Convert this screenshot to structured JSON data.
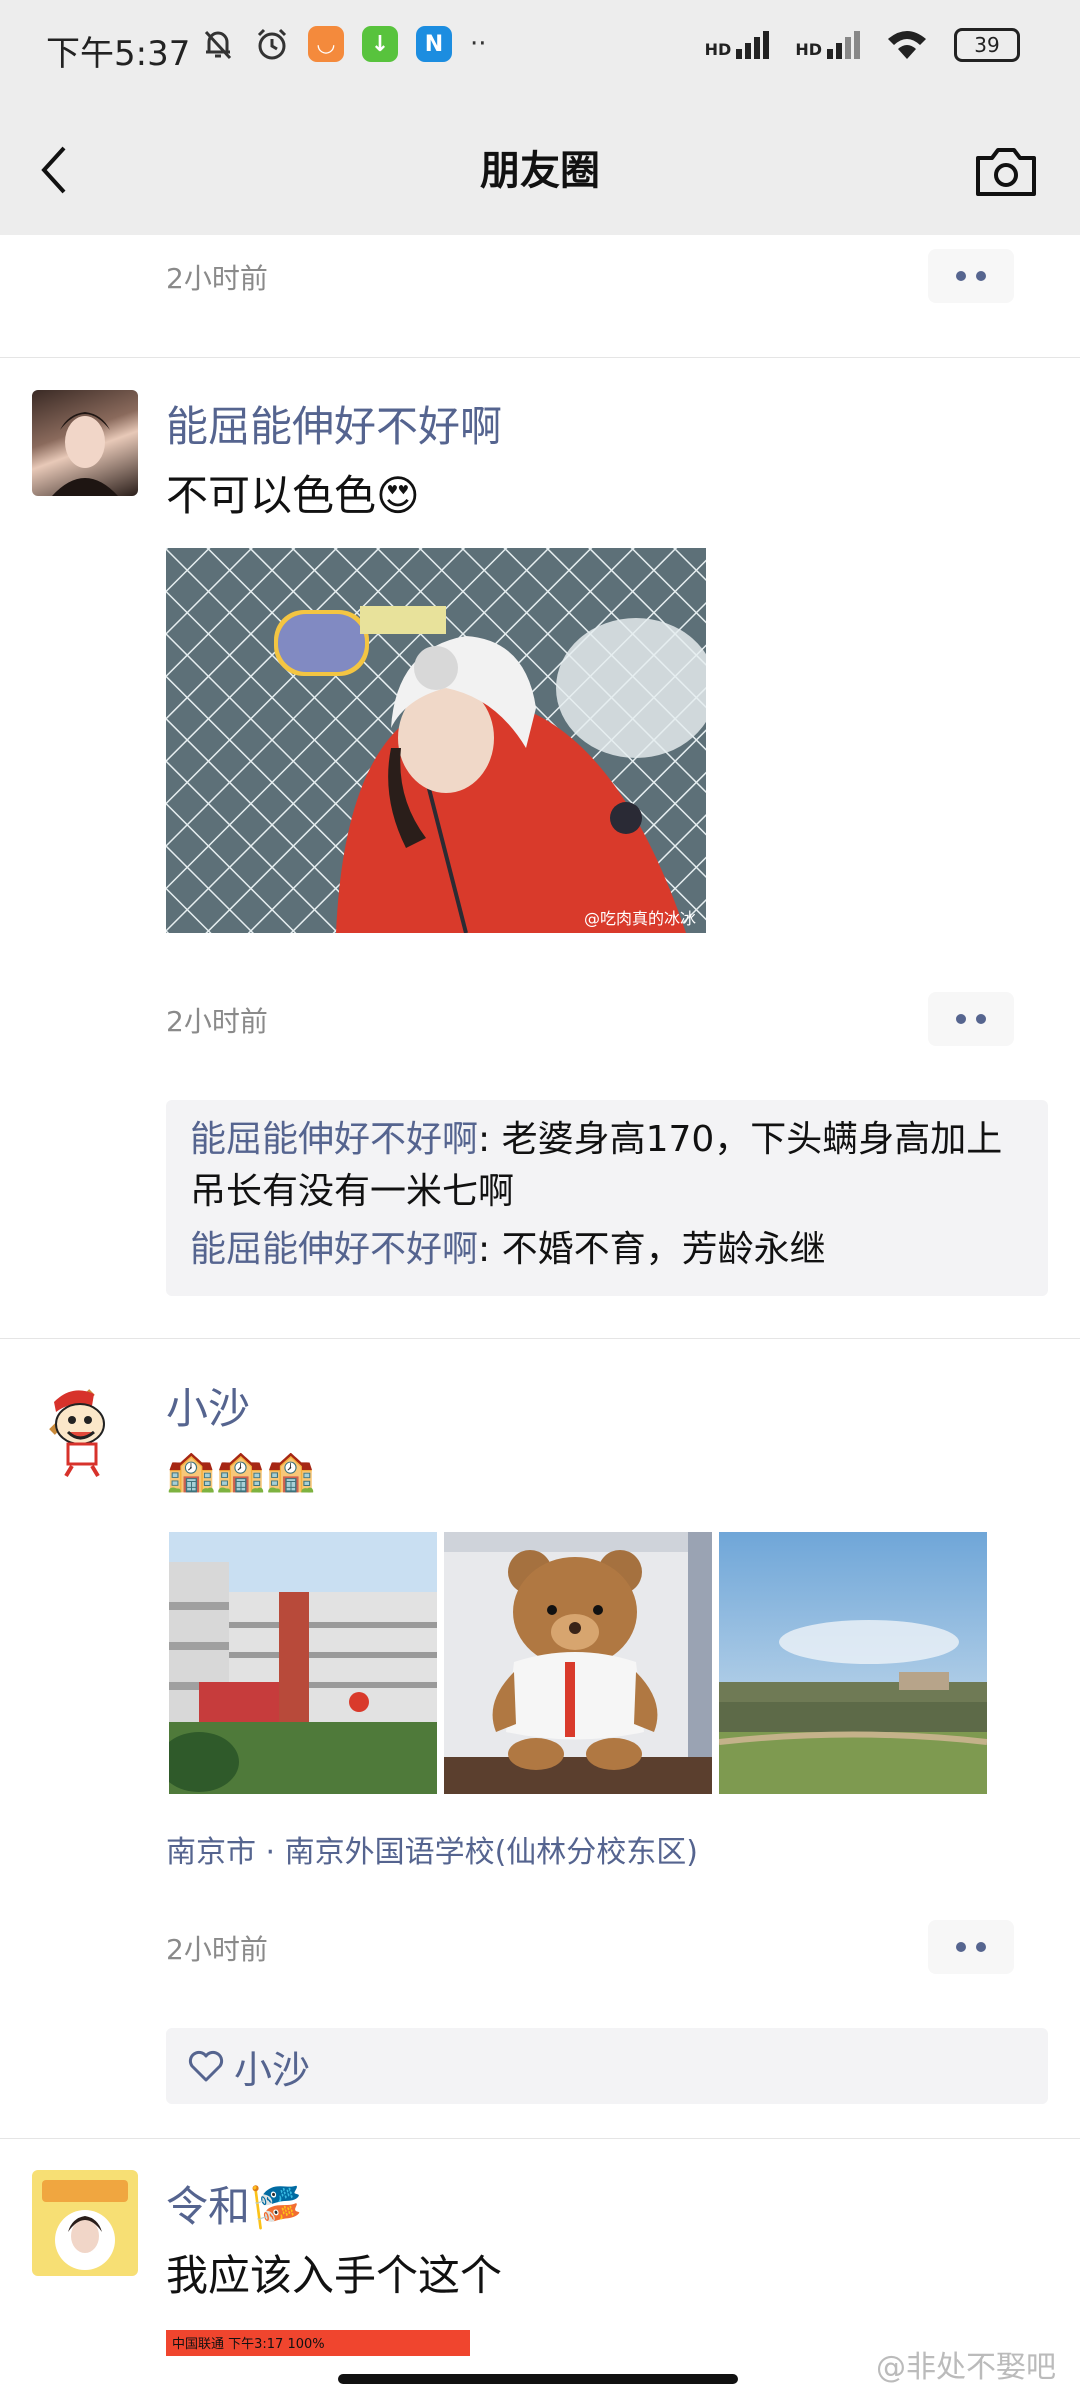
{
  "status": {
    "time": "下午5:37",
    "battery": "39",
    "hd1": "HD",
    "hd2": "HD"
  },
  "nav": {
    "title": "朋友圈"
  },
  "posts": [
    {
      "time": "2小时前"
    },
    {
      "name": "能屈能伸好不好啊",
      "text": "不可以色色😍",
      "image_watermark": "@吃肉真的冰冰",
      "time": "2小时前",
      "comments": [
        {
          "name": "能屈能伸好不好啊",
          "sep": ": ",
          "text": "老婆身高170，下头螨身高加上吊长有没有一米七啊"
        },
        {
          "name": "能屈能伸好不好啊",
          "sep": ": ",
          "text": "不婚不育，芳龄永继"
        }
      ]
    },
    {
      "name": "小沙",
      "text": "🏫🏫🏫",
      "location": "南京市 · 南京外国语学校(仙林分校东区)",
      "time": "2小时前",
      "likes": "小沙"
    },
    {
      "name": "令和🎏",
      "text": "我应该入手个这个",
      "thumb_status": "中国联通   下午3:17   100%"
    }
  ],
  "watermark": "@非处不娶吧",
  "colors": {
    "name": "#55648f",
    "bg_header": "#ededed"
  }
}
